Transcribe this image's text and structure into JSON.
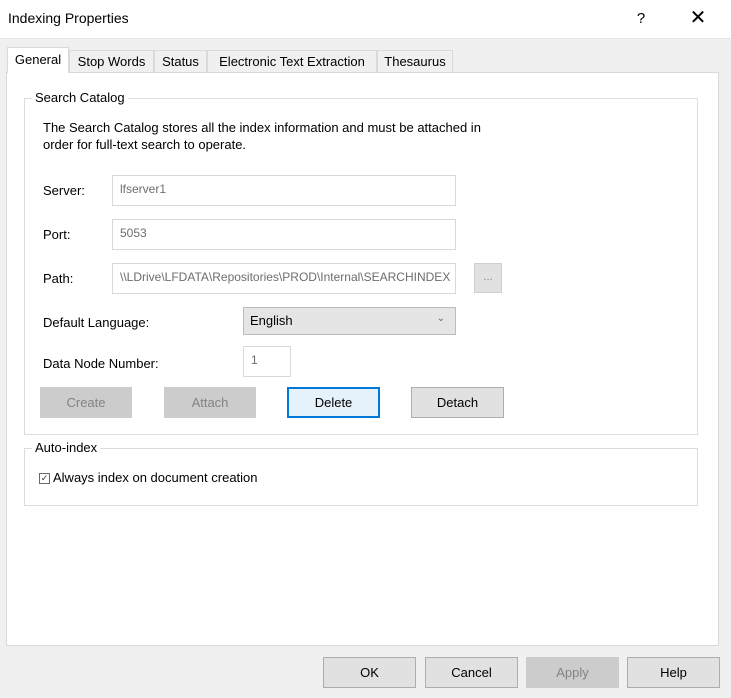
{
  "window": {
    "title": "Indexing Properties",
    "help_glyph": "?",
    "close_glyph": "✕"
  },
  "tabs": [
    {
      "label": "General"
    },
    {
      "label": "Stop Words"
    },
    {
      "label": "Status"
    },
    {
      "label": "Electronic Text Extraction"
    },
    {
      "label": "Thesaurus"
    }
  ],
  "search_catalog": {
    "legend": "Search Catalog",
    "description_line1": "The Search Catalog stores all the index information and must be attached in",
    "description_line2": "order for full-text search to operate.",
    "server_label": "Server:",
    "server_value": "lfserver1",
    "port_label": "Port:",
    "port_value": "5053",
    "path_label": "Path:",
    "path_value": "\\\\LDrive\\LFDATA\\Repositories\\PROD\\Internal\\SEARCHINDEX",
    "browse_label": "...",
    "language_label": "Default Language:",
    "language_value": "English",
    "data_node_label": "Data Node Number:",
    "data_node_value": "1",
    "create_label": "Create",
    "attach_label": "Attach",
    "delete_label": "Delete",
    "detach_label": "Detach"
  },
  "auto_index": {
    "legend": "Auto-index",
    "always_index_label": "Always index on document creation",
    "always_index_checked": true
  },
  "footer": {
    "ok_label": "OK",
    "cancel_label": "Cancel",
    "apply_label": "Apply",
    "help_label": "Help"
  }
}
